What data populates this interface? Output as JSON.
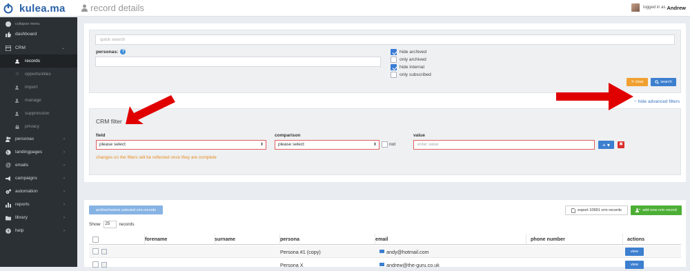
{
  "brand": {
    "name": "kulea.ma"
  },
  "header": {
    "title": "record details",
    "logged_in_prefix": "logged in as",
    "user": "Andrew"
  },
  "sidebar": {
    "collapse_label": "collapse menu",
    "items": [
      {
        "label": "dashboard",
        "icon": "thumbs-up-icon"
      },
      {
        "label": "CRM",
        "icon": "table-icon",
        "chevron": "⌄"
      },
      {
        "label": "records",
        "icon": "user-icon"
      },
      {
        "label": "opportunities",
        "icon": "star-icon"
      },
      {
        "label": "import",
        "icon": "user-plus-icon"
      },
      {
        "label": "manage",
        "icon": "user-edit-icon"
      },
      {
        "label": "suppression",
        "icon": "user-minus-icon"
      },
      {
        "label": "privacy",
        "icon": "lock-icon"
      },
      {
        "label": "personas",
        "icon": "users-icon",
        "chevron": "›"
      },
      {
        "label": "landingpages",
        "icon": "globe-icon",
        "chevron": "›"
      },
      {
        "label": "emails",
        "icon": "at-icon",
        "chevron": "›"
      },
      {
        "label": "campaigns",
        "icon": "bullhorn-icon",
        "chevron": "›"
      },
      {
        "label": "automation",
        "icon": "cogs-icon",
        "chevron": "›"
      },
      {
        "label": "reports",
        "icon": "bar-chart-icon",
        "chevron": "›"
      },
      {
        "label": "library",
        "icon": "folder-icon",
        "chevron": "›"
      },
      {
        "label": "help",
        "icon": "question-icon",
        "chevron": "›"
      }
    ]
  },
  "search": {
    "quick_placeholder": "quick search",
    "personas_label": "personas:",
    "options": [
      {
        "label": "hide archived",
        "checked": true
      },
      {
        "label": "only archived",
        "checked": false
      },
      {
        "label": "hide internal",
        "checked": true
      },
      {
        "label": "only subscribed",
        "checked": false
      }
    ],
    "clear_label": "✕ clear",
    "search_label": "search"
  },
  "filters": {
    "hide_advanced": "hide advanced filters",
    "crm_title": "CRM filter",
    "field_label": "field",
    "comparison_label": "comparison",
    "value_label": "value",
    "field_value": "please select",
    "comparison_value": "please select",
    "not_label": "not",
    "value_placeholder": "enter value",
    "plus_label": "+ ▾",
    "remove_label": "✖",
    "note": "changes on the filters will be reflected once they are complete"
  },
  "records": {
    "archive_btn": "archive/restore selected crm records",
    "export_btn": "export 10691 crm records",
    "add_btn": "add new crm record",
    "show_label": "Show",
    "show_value": "25",
    "show_suffix": "records",
    "columns": [
      "forename",
      "surname",
      "persona",
      "email",
      "phone number",
      "actions"
    ],
    "rows": [
      {
        "forename": "",
        "surname": "",
        "persona": "Persona #1 (copy)",
        "email": "andy@hotmail.com",
        "phone": "",
        "action": "view"
      },
      {
        "forename": "",
        "surname": "",
        "persona": "Persona X",
        "email": "andrew@the-guru.co.uk",
        "phone": "",
        "action": "view"
      }
    ]
  },
  "colors": {
    "accent": "#3c7fcf",
    "sidebar": "#2b3034",
    "danger": "#e00000",
    "success": "#4caf35",
    "warning": "#f0a030"
  }
}
